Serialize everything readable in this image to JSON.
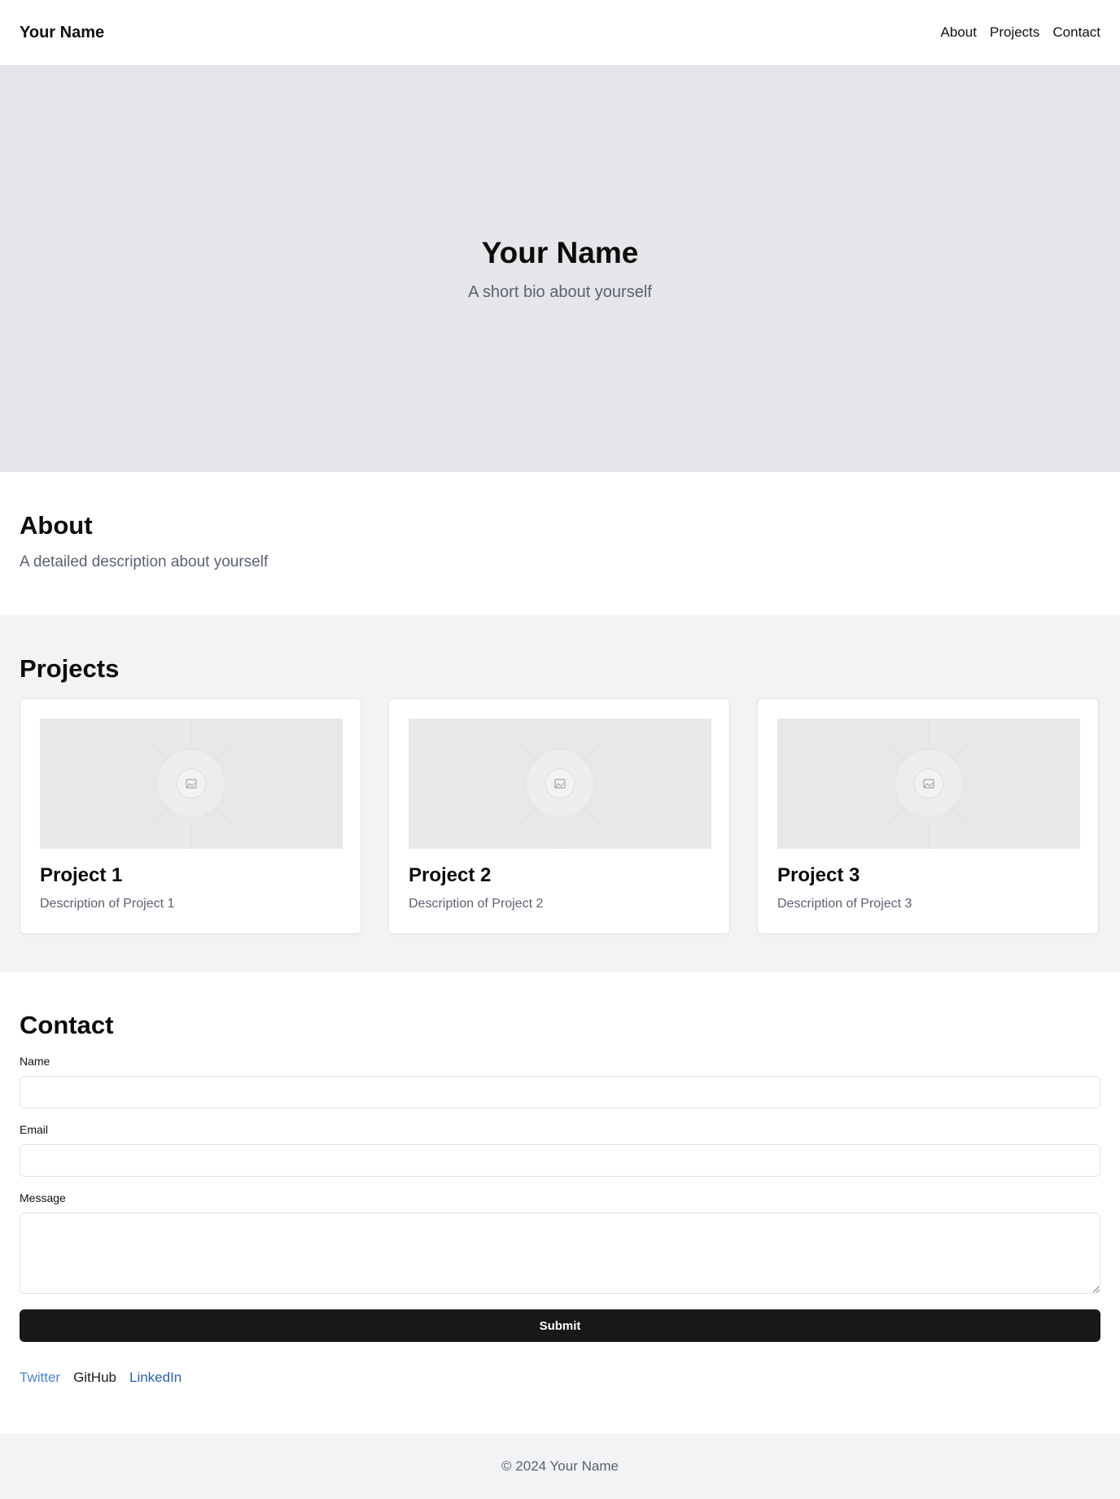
{
  "header": {
    "brand": "Your Name",
    "nav": [
      "About",
      "Projects",
      "Contact"
    ]
  },
  "hero": {
    "title": "Your Name",
    "subtitle": "A short bio about yourself"
  },
  "about": {
    "title": "About",
    "text": "A detailed description about yourself"
  },
  "projects": {
    "title": "Projects",
    "items": [
      {
        "title": "Project 1",
        "description": "Description of Project 1",
        "image_icon": "image-placeholder-icon"
      },
      {
        "title": "Project 2",
        "description": "Description of Project 2",
        "image_icon": "image-placeholder-icon"
      },
      {
        "title": "Project 3",
        "description": "Description of Project 3",
        "image_icon": "image-placeholder-icon"
      }
    ]
  },
  "contact": {
    "title": "Contact",
    "fields": {
      "name_label": "Name",
      "name_value": "",
      "email_label": "Email",
      "email_value": "",
      "message_label": "Message",
      "message_value": ""
    },
    "submit_label": "Submit",
    "social": [
      {
        "label": "Twitter",
        "color": "#4a83d6"
      },
      {
        "label": "GitHub",
        "color": "#1a1a1a"
      },
      {
        "label": "LinkedIn",
        "color": "#2f5fb3"
      }
    ]
  },
  "footer": {
    "text": "© 2024 Your Name"
  },
  "colors": {
    "hero_bg": "#e5e6e9",
    "section_alt_bg": "#f2f3f5",
    "button_bg": "#18181b",
    "muted_text": "#5b6270"
  }
}
